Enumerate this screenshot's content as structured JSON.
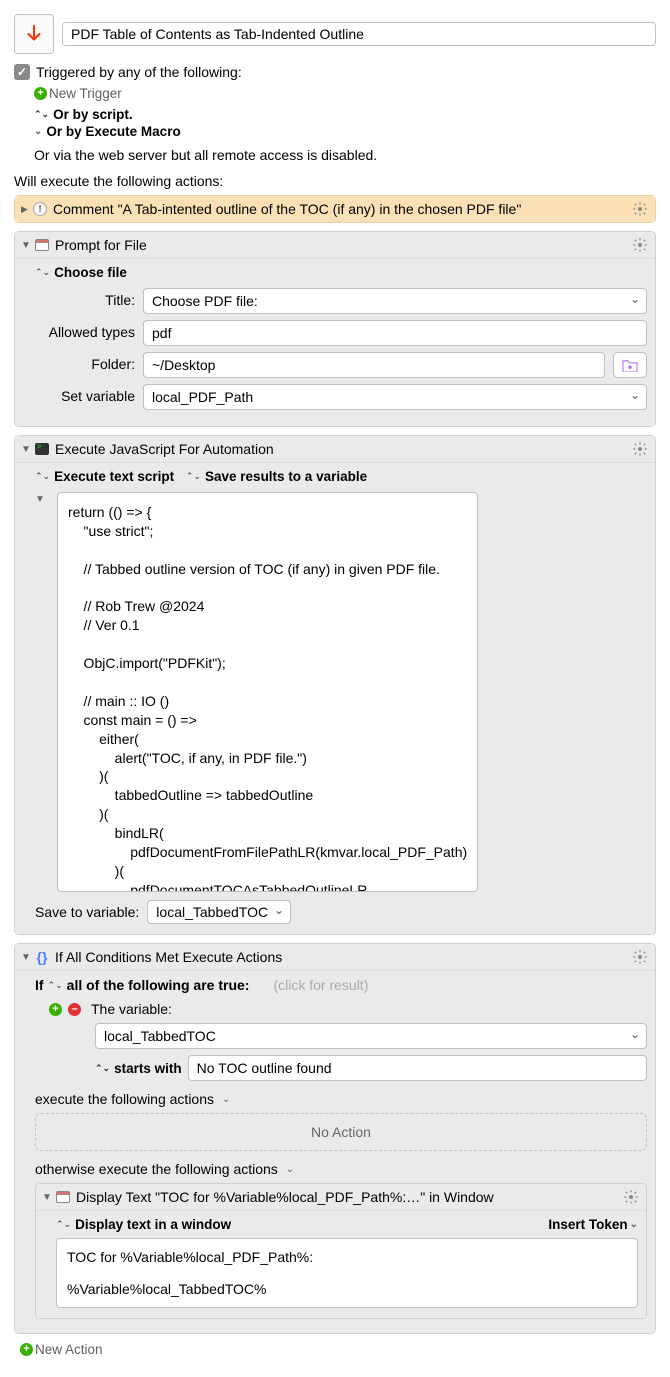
{
  "title": "PDF Table of Contents as Tab-Indented Outline",
  "triggered_label": "Triggered by any of the following:",
  "new_trigger": "New Trigger",
  "or_script": "Or by script.",
  "or_execute_macro": "Or by Execute Macro",
  "web_disabled": "Or via the web server but all remote access is disabled.",
  "exec_label": "Will execute the following actions:",
  "comment": {
    "title": "Comment \"A Tab-intented outline of the TOC (if any) in the chosen PDF file\""
  },
  "prompt": {
    "title": "Prompt for File",
    "choose": "Choose file",
    "rows": {
      "title_label": "Title:",
      "title_value": "Choose PDF file:",
      "allowed_label": "Allowed types",
      "allowed_value": "pdf",
      "folder_label": "Folder:",
      "folder_value": "~/Desktop",
      "setvar_label": "Set variable",
      "setvar_value": "local_PDF_Path"
    }
  },
  "jxa": {
    "title": "Execute JavaScript For Automation",
    "opts": {
      "a": "Execute text script",
      "b": "Save results to a variable"
    },
    "code": "return (() => {\n    \"use strict\";\n\n    // Tabbed outline version of TOC (if any) in given PDF file.\n\n    // Rob Trew @2024\n    // Ver 0.1\n\n    ObjC.import(\"PDFKit\");\n\n    // main :: IO ()\n    const main = () =>\n        either(\n            alert(\"TOC, if any, in PDF file.\")\n        )(\n            tabbedOutline => tabbedOutline\n        )(\n            bindLR(\n                pdfDocumentFromFilePathLR(kmvar.local_PDF_Path)\n            )(\n                pdfDocumentTOCAsTabbedOutlineLR",
    "save_label": "Save to variable:",
    "save_value": "local_TabbedTOC"
  },
  "ifblock": {
    "title": "If All Conditions Met Execute Actions",
    "if_label": "If",
    "all_true": "all of the following are true:",
    "click_result": "(click for result)",
    "var_label": "The variable:",
    "var_value": "local_TabbedTOC",
    "op": "starts with",
    "op_value": "No TOC outline found",
    "exec_following": "execute the following actions",
    "no_action": "No Action",
    "otherwise": "otherwise execute the following actions",
    "display": {
      "title": "Display Text \"TOC for %Variable%local_PDF_Path%:…\" in Window",
      "opt": "Display text in a window",
      "insert_token": "Insert Token",
      "body": "TOC for %Variable%local_PDF_Path%:\n\n%Variable%local_TabbedTOC%"
    }
  },
  "new_action": "New Action"
}
